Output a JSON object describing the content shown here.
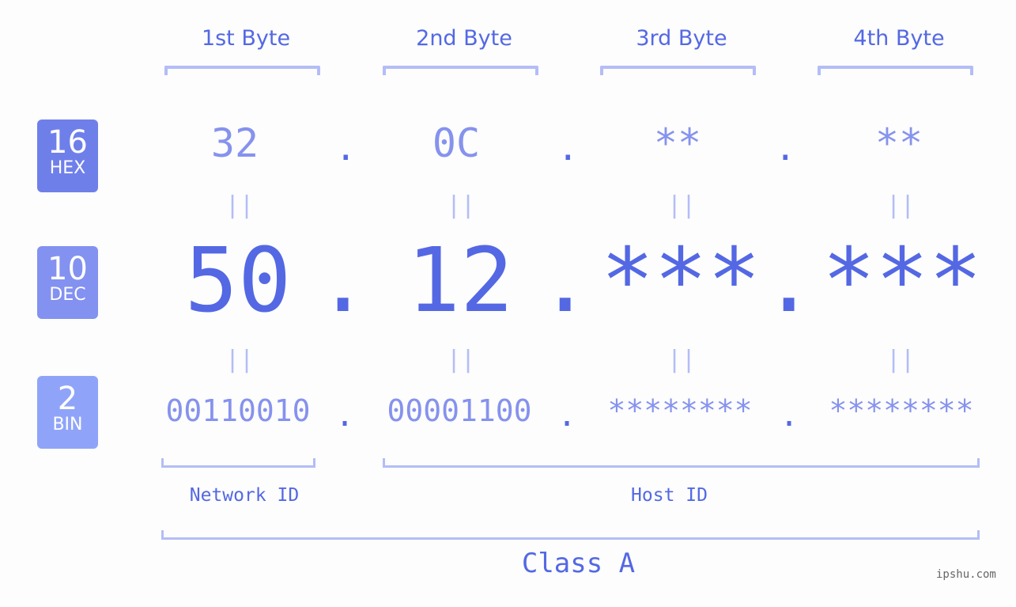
{
  "byte_headers": [
    "1st Byte",
    "2nd Byte",
    "3rd Byte",
    "4th Byte"
  ],
  "badges": [
    {
      "number": "16",
      "label": "HEX",
      "color": "#6f7fea"
    },
    {
      "number": "10",
      "label": "DEC",
      "color": "#8391f1"
    },
    {
      "number": "2",
      "label": "BIN",
      "color": "#8fa4f9"
    }
  ],
  "hex": [
    "32",
    "0C",
    "**",
    "**"
  ],
  "dec": [
    "50",
    "12",
    "***",
    "***"
  ],
  "bin": [
    "00110010",
    "00001100",
    "********",
    "********"
  ],
  "separator": ".",
  "equals": "||",
  "network_label": "Network ID",
  "host_label": "Host ID",
  "class_label": "Class A",
  "watermark": "ipshu.com",
  "colors": {
    "accent": "#5468e4",
    "light": "#8692ee",
    "bracket": "#b4bdf7"
  }
}
